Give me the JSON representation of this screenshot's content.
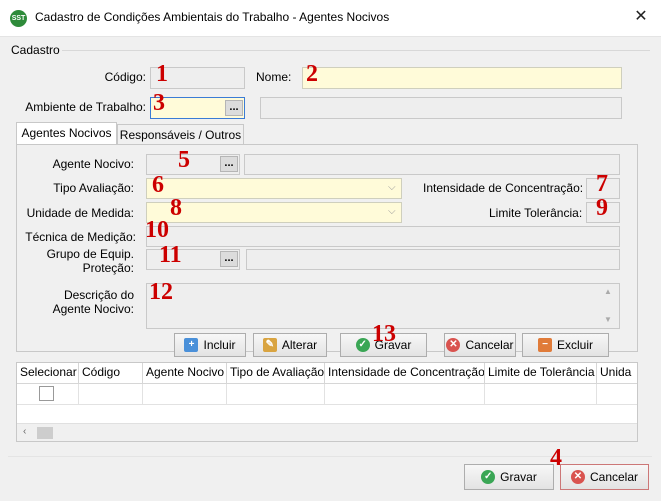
{
  "window": {
    "title": "Cadastro de Condições Ambientais do Trabalho - Agentes Nocivos",
    "icon_text": "SST",
    "close": "✕"
  },
  "group_label": "Cadastro",
  "header": {
    "codigo_label": "Código:",
    "codigo_marker": "1",
    "nome_label": "Nome:",
    "nome_marker": "2",
    "ambiente_label": "Ambiente de Trabalho:",
    "ambiente_marker": "3",
    "ellipsis": "..."
  },
  "tabs": [
    {
      "label": "Agentes Nocivos"
    },
    {
      "label": "Responsáveis / Outros"
    }
  ],
  "form": {
    "agente_label": "Agente Nocivo:",
    "agente_marker": "5",
    "tipo_label": "Tipo Avaliação:",
    "tipo_marker": "6",
    "intensidade_label": "Intensidade de Concentração:",
    "intensidade_marker": "7",
    "unidade_label": "Unidade de Medida:",
    "unidade_marker": "8",
    "limite_label": "Limite Tolerância:",
    "limite_marker": "9",
    "tecnica_label": "Técnica de Medição:",
    "tecnica_marker": "10",
    "grupo_label_1": "Grupo de Equip.",
    "grupo_label_2": "Proteção:",
    "grupo_marker": "11",
    "descricao_label_1": "Descrição do",
    "descricao_label_2": "Agente Nocivo:",
    "descricao_marker": "12"
  },
  "actions": {
    "incluir": "Incluir",
    "alterar": "Alterar",
    "gravar": "Gravar",
    "gravar_marker": "13",
    "cancelar": "Cancelar",
    "excluir": "Excluir"
  },
  "table": {
    "columns": [
      "Selecionar",
      "Código",
      "Agente Nocivo",
      "Tipo de Avaliação",
      "Intensidade de Concentração",
      "Limite de Tolerância",
      "Unida"
    ]
  },
  "footer": {
    "gravar": "Gravar",
    "cancelar": "Cancelar",
    "marker": "4"
  },
  "colors": {
    "accent": "#cc0000",
    "field_yellow": "#fffbd9"
  }
}
